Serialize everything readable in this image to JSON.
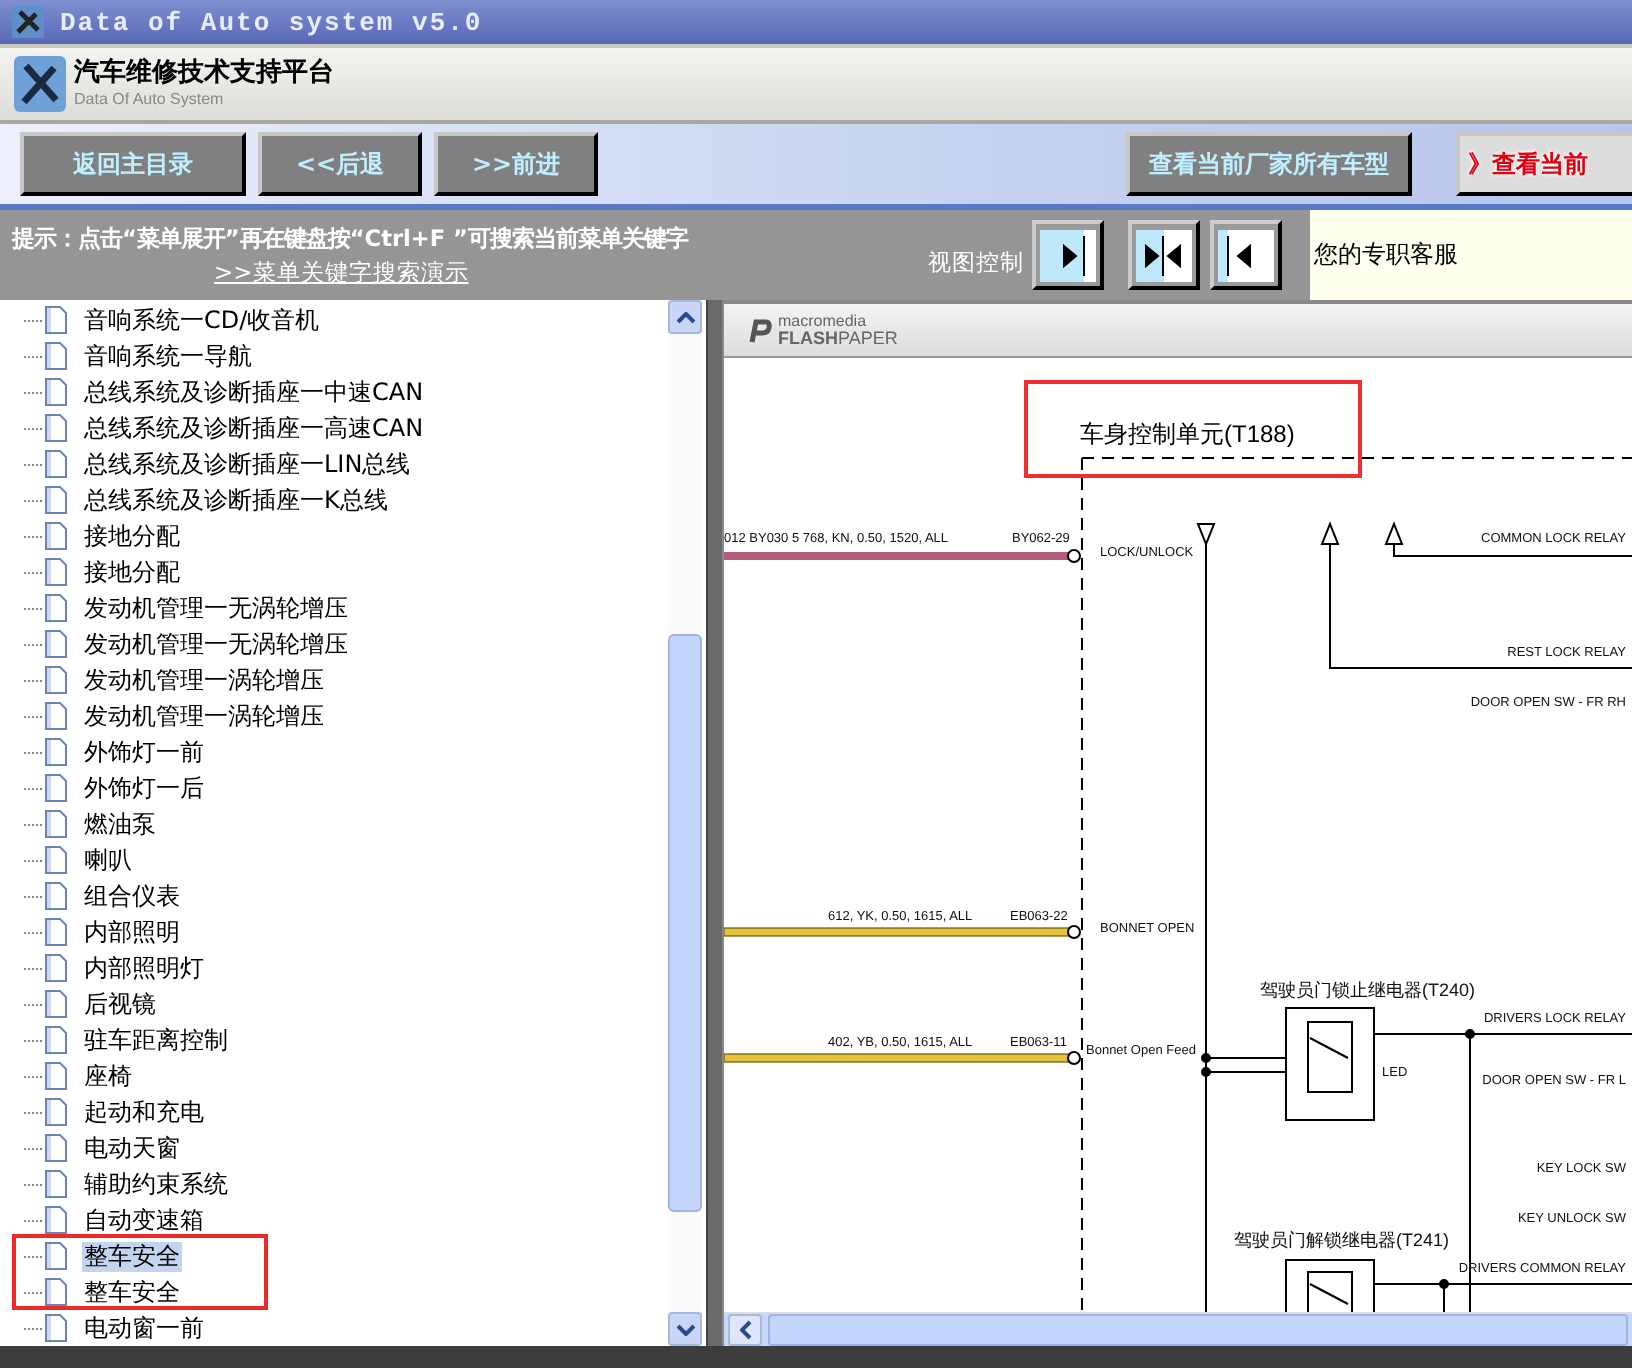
{
  "window": {
    "title": "Data of Auto system v5.0"
  },
  "header": {
    "title": "汽车维修技术支持平台",
    "subtitle": "Data Of Auto System"
  },
  "toolbar": {
    "left_buttons": [
      "返回主目录",
      "<<后退",
      ">>前进"
    ],
    "models_button": "查看当前厂家所有车型",
    "current_button": "》查看当前"
  },
  "hint": {
    "text": "提示：点击“菜单展开”再在键盘按“Ctrl+F ”可搜索当前菜单关键字",
    "link": ">>菜单关键字搜索演示",
    "view_label": "视图控制",
    "support": "您的专职客服"
  },
  "view_buttons": [
    {
      "kind": "right"
    },
    {
      "kind": "split"
    },
    {
      "kind": "left"
    }
  ],
  "tree": {
    "items": [
      {
        "label": "音响系统一CD/收音机",
        "selected": false
      },
      {
        "label": "音响系统一导航",
        "selected": false
      },
      {
        "label": "总线系统及诊断插座一中速CAN",
        "selected": false
      },
      {
        "label": "总线系统及诊断插座一高速CAN",
        "selected": false
      },
      {
        "label": "总线系统及诊断插座一LIN总线",
        "selected": false
      },
      {
        "label": "总线系统及诊断插座一K总线",
        "selected": false
      },
      {
        "label": "接地分配",
        "selected": false
      },
      {
        "label": "接地分配",
        "selected": false
      },
      {
        "label": "发动机管理一无涡轮增压",
        "selected": false
      },
      {
        "label": "发动机管理一无涡轮增压",
        "selected": false
      },
      {
        "label": "发动机管理一涡轮增压",
        "selected": false
      },
      {
        "label": "发动机管理一涡轮增压",
        "selected": false
      },
      {
        "label": "外饰灯一前",
        "selected": false
      },
      {
        "label": "外饰灯一后",
        "selected": false
      },
      {
        "label": "燃油泵",
        "selected": false
      },
      {
        "label": "喇叭",
        "selected": false
      },
      {
        "label": "组合仪表",
        "selected": false
      },
      {
        "label": "内部照明",
        "selected": false
      },
      {
        "label": "内部照明灯",
        "selected": false
      },
      {
        "label": "后视镜",
        "selected": false
      },
      {
        "label": "驻车距离控制",
        "selected": false
      },
      {
        "label": "座椅",
        "selected": false
      },
      {
        "label": "起动和充电",
        "selected": false
      },
      {
        "label": "电动天窗",
        "selected": false
      },
      {
        "label": "辅助约束系统",
        "selected": false
      },
      {
        "label": "自动变速箱",
        "selected": false
      },
      {
        "label": "整车安全",
        "selected": true
      },
      {
        "label": "整车安全",
        "selected": false
      },
      {
        "label": "电动窗一前",
        "selected": false
      }
    ]
  },
  "viewer": {
    "brand_top": "macromedia",
    "brand_bold": "FLASH",
    "brand_light": "PAPER",
    "diagram": {
      "title": "车身控制单元(T188)",
      "labels": [
        "012 BY030 5  768, KN, 0.50, 1520, ALL",
        "BY062-29",
        "LOCK/UNLOCK",
        "COMMON LOCK RELAY",
        "REST LOCK RELAY",
        "DOOR OPEN SW - FR RH",
        "612, YK, 0.50, 1615, ALL",
        "EB063-22",
        "BONNET OPEN",
        "驾驶员门锁止继电器(T240)",
        "402, YB, 0.50, 1615, ALL",
        "EB063-11",
        "Bonnet Open Feed",
        "LED",
        "DRIVERS LOCK RELAY",
        "DOOR OPEN SW - FR L",
        "KEY LOCK SW",
        "KEY UNLOCK SW",
        "驾驶员门解锁继电器(T241)",
        "DRIVERS COMMON RELAY"
      ]
    }
  }
}
